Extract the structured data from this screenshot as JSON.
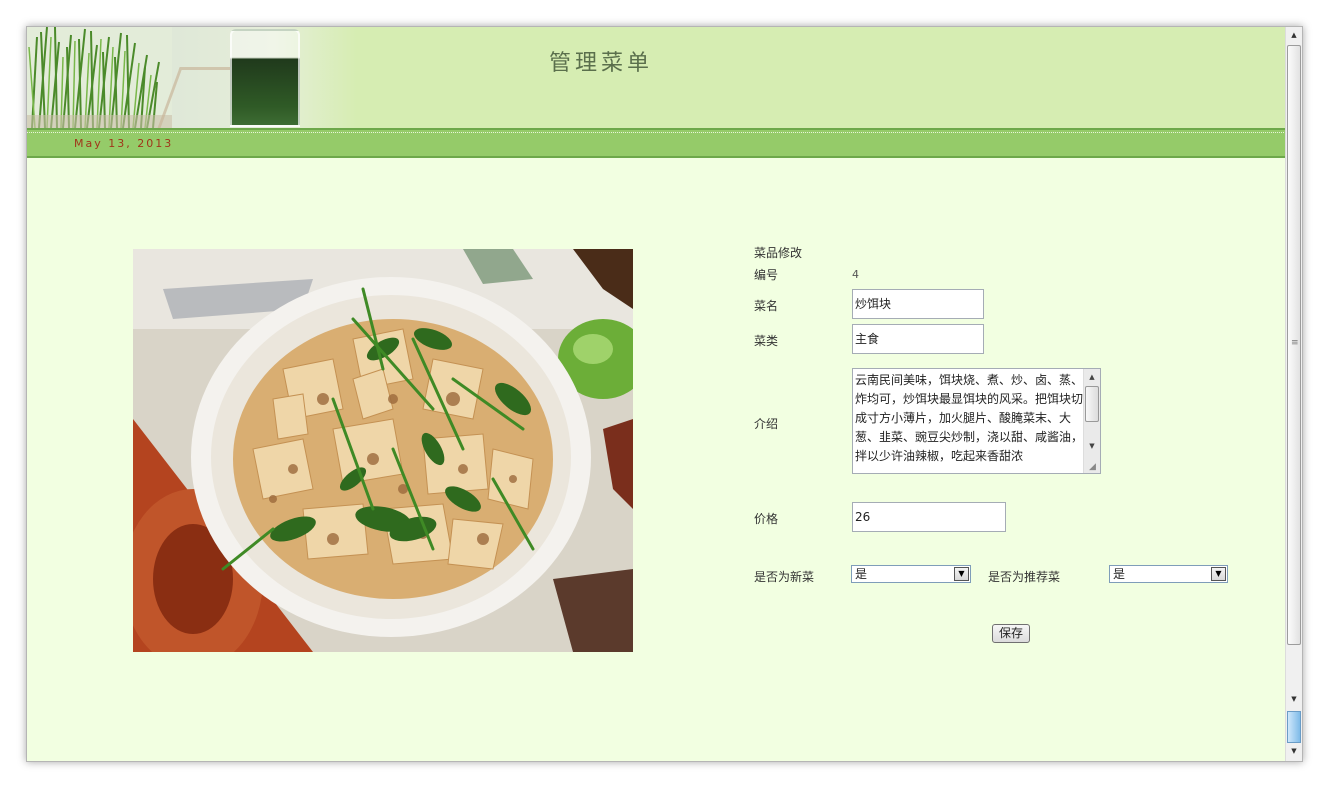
{
  "header": {
    "title": "管理菜单",
    "date": "May 13, 2013"
  },
  "form": {
    "section_title": "菜品修改",
    "id_label": "编号",
    "id_value": "4",
    "name_label": "菜名",
    "name_value": "炒饵块",
    "category_label": "菜类",
    "category_value": "主食",
    "intro_label": "介绍",
    "intro_value": "云南民间美味，饵块烧、煮、炒、卤、蒸、炸均可，炒饵块最显饵块的风采。把饵块切成寸方小薄片，加火腿片、酸腌菜末、大葱、韭菜、豌豆尖炒制，浇以甜、咸酱油，拌以少许油辣椒，吃起来香甜浓",
    "price_label": "价格",
    "price_value": "26",
    "is_new_label": "是否为新菜",
    "is_new_value": "是",
    "is_recommended_label": "是否为推荐菜",
    "is_recommended_value": "是",
    "save_label": "保存"
  },
  "icons": {
    "scroll_up": "up-arrow-icon",
    "scroll_down": "down-arrow-icon",
    "dropdown": "chevron-down-icon"
  },
  "colors": {
    "page_background": "#f2ffe1",
    "header_background": "#d6edb2",
    "date_bar": "#95cb69",
    "date_text": "#a0361a"
  }
}
